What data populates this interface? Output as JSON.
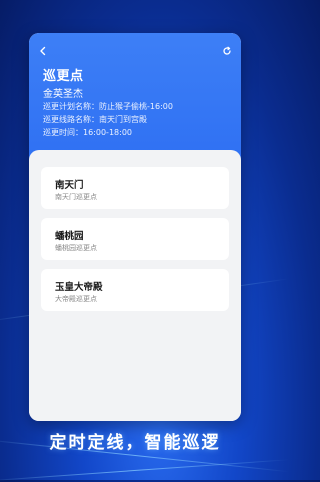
{
  "header": {
    "title": "巡更点",
    "person": "金英圣杰",
    "plan_line": "巡更计划名称：防止猴子偷桃-16:00",
    "route_line": "巡更线路名称：南天门到宫殿",
    "time_line": "巡更时间：16:00-18:00"
  },
  "icons": {
    "back": "chevron-left-icon",
    "refresh": "refresh-icon"
  },
  "points": [
    {
      "name": "南天门",
      "sub": "南天门巡更点"
    },
    {
      "name": "蟠桃园",
      "sub": "蟠桃园巡更点"
    },
    {
      "name": "玉皇大帝殿",
      "sub": "大帝殿巡更点"
    }
  ],
  "slogan": "定时定线，智能巡逻",
  "colors": {
    "accent": "#2d6ef2",
    "background": "#1247c9"
  }
}
